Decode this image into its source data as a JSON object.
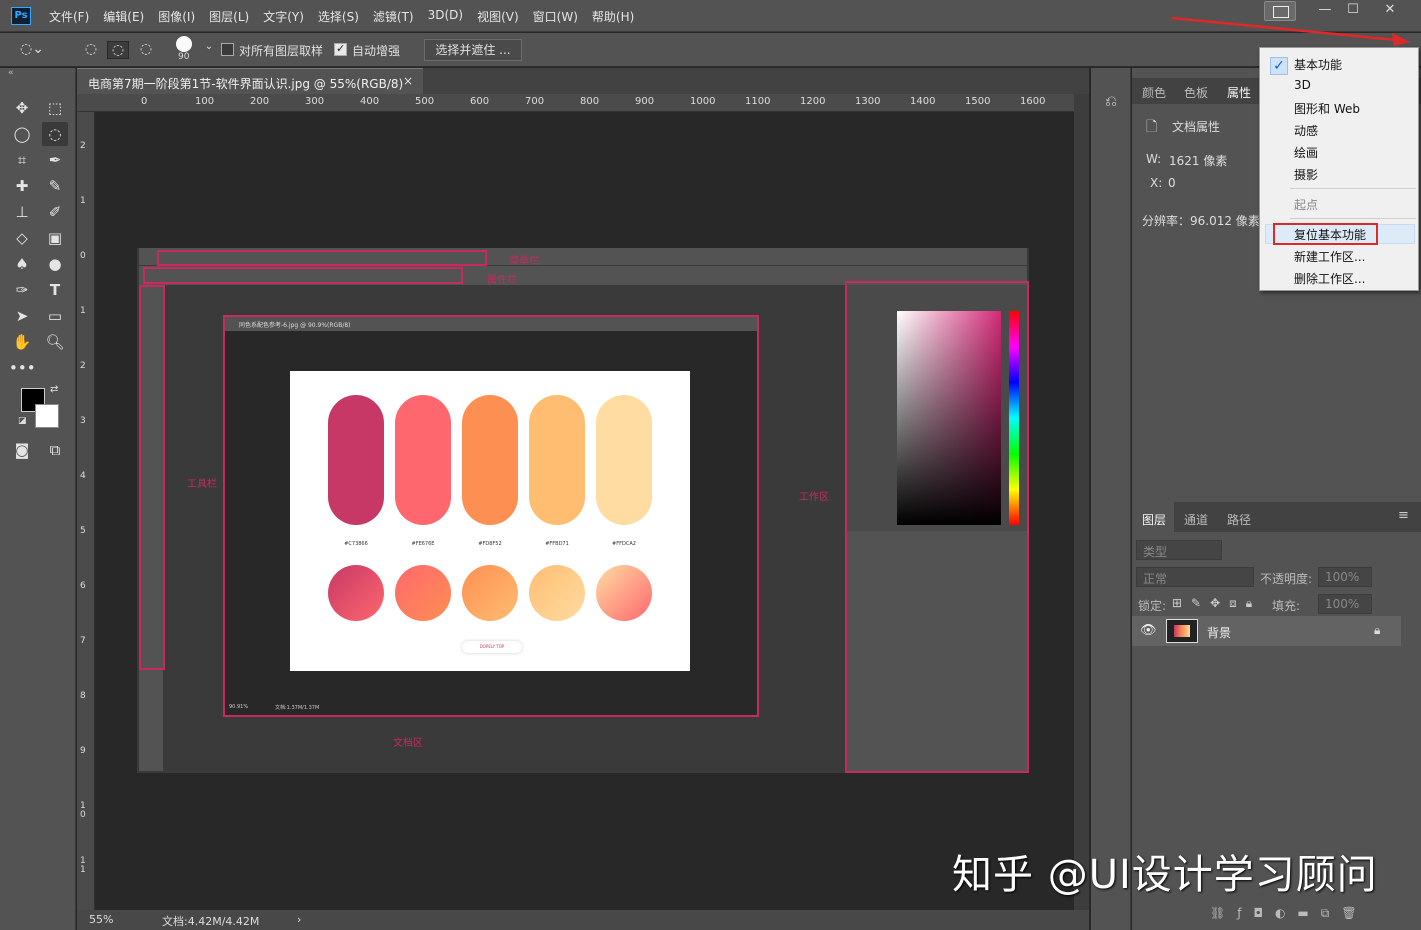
{
  "app": {
    "logo": "Ps"
  },
  "menubar": {
    "items": [
      "文件(F)",
      "编辑(E)",
      "图像(I)",
      "图层(L)",
      "文字(Y)",
      "选择(S)",
      "滤镜(T)",
      "3D(D)",
      "视图(V)",
      "窗口(W)",
      "帮助(H)"
    ]
  },
  "optionsbar": {
    "brush_size": "90",
    "sample_all_label": "对所有图层取样",
    "auto_enhance_label": "自动增强",
    "select_mask_button": "选择并遮住 ..."
  },
  "document": {
    "tab_title": "电商第7期一阶段第1节-软件界面认识.jpg @ 55%(RGB/8)",
    "zoom": "55%",
    "doc_size": "文档:4.42M/4.42M",
    "ruler_h": [
      "0",
      "100",
      "200",
      "300",
      "400",
      "500",
      "600",
      "700",
      "800",
      "900",
      "1000",
      "1100",
      "1200",
      "1300",
      "1400",
      "1500",
      "1600"
    ],
    "ruler_v": [
      "2",
      "1",
      "0",
      "1",
      "2",
      "3",
      "4",
      "5",
      "6",
      "7",
      "8",
      "9",
      "1 0",
      "1 1"
    ]
  },
  "embedded": {
    "labels": {
      "menubar": "菜单栏",
      "optionsbar": "属性栏",
      "toolbar": "工具栏",
      "workspace": "工作区",
      "docarea": "文档区"
    },
    "inner_title": "同色系配色参考-6.jpg @ 90.9%(RGB/8)",
    "inner_zoom": "90.91%",
    "inner_doc": "文档:1.37M/1.37M",
    "swatches": [
      {
        "hex": "#C73866",
        "color": "#c73866"
      },
      {
        "hex": "#FE676E",
        "color": "#fe676e"
      },
      {
        "hex": "#FD8F52",
        "color": "#fd8f52"
      },
      {
        "hex": "#FFBD71",
        "color": "#ffbd71"
      },
      {
        "hex": "#FFDCA2",
        "color": "#ffdca2"
      }
    ],
    "badge": "DOPELY TOP"
  },
  "right_panel": {
    "top_tabs": [
      "颜色",
      "色板",
      "属性"
    ],
    "doc_props_label": "文档属性",
    "w_label": "W:",
    "w_value": "1621 像素",
    "x_label": "X:",
    "x_value": "0",
    "resolution": "分辨率：96.012 像素/英",
    "layer_tabs": [
      "图层",
      "通道",
      "路径"
    ],
    "kind_placeholder": "类型",
    "blend_mode": "正常",
    "opacity_label": "不透明度:",
    "opacity_value": "100%",
    "lock_label": "锁定:",
    "fill_label": "填充:",
    "fill_value": "100%",
    "layer_name": "背景"
  },
  "workspace_menu": {
    "items": [
      "基本功能",
      "3D",
      "图形和 Web",
      "动感",
      "绘画",
      "摄影"
    ],
    "origin": "起点",
    "reset": "复位基本功能",
    "new_ws": "新建工作区...",
    "delete_ws": "删除工作区..."
  },
  "watermark": "知乎 @UI设计学习顾问"
}
